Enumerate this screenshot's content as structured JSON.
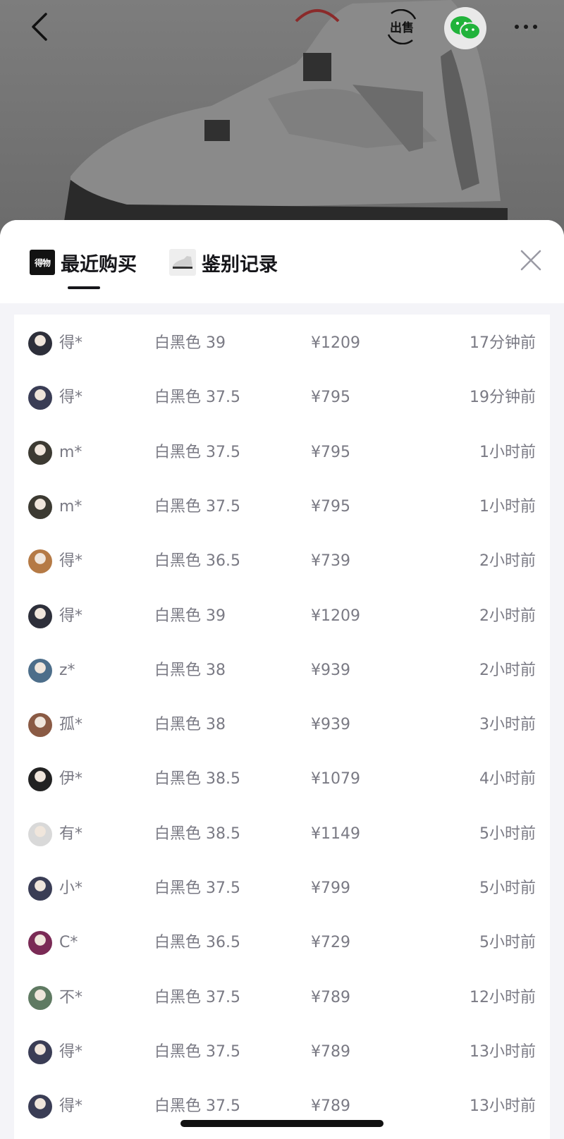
{
  "topbar": {
    "back_icon": "chevron-left-icon",
    "sell_icon": "sell-label-icon",
    "sell_label": "出售",
    "wechat_icon": "wechat-icon",
    "more_icon": "more-dots-icon"
  },
  "tabs": [
    {
      "label": "最近购买",
      "icon": "dewu-logo-icon",
      "icon_text": "得物",
      "active": true
    },
    {
      "label": "鉴别记录",
      "icon": "sneaker-thumbnail-icon",
      "active": false
    }
  ],
  "close_icon": "close-icon",
  "purchases": [
    {
      "name": "得*",
      "spec": "白黑色 39",
      "price": "¥1209",
      "time": "17分钟前",
      "avatar_color": "#2d2f3a"
    },
    {
      "name": "得*",
      "spec": "白黑色 37.5",
      "price": "¥795",
      "time": "19分钟前",
      "avatar_color": "#3a3d55"
    },
    {
      "name": "m*",
      "spec": "白黑色 37.5",
      "price": "¥795",
      "time": "1小时前",
      "avatar_color": "#3c3a32"
    },
    {
      "name": "m*",
      "spec": "白黑色 37.5",
      "price": "¥795",
      "time": "1小时前",
      "avatar_color": "#3c3a32"
    },
    {
      "name": "得*",
      "spec": "白黑色 36.5",
      "price": "¥739",
      "time": "2小时前",
      "avatar_color": "#b57a45"
    },
    {
      "name": "得*",
      "spec": "白黑色 39",
      "price": "¥1209",
      "time": "2小时前",
      "avatar_color": "#2d2f3a"
    },
    {
      "name": "z*",
      "spec": "白黑色 38",
      "price": "¥939",
      "time": "2小时前",
      "avatar_color": "#4d6e8a"
    },
    {
      "name": "孤*",
      "spec": "白黑色 38",
      "price": "¥939",
      "time": "3小时前",
      "avatar_color": "#8a5a44"
    },
    {
      "name": "伊*",
      "spec": "白黑色 38.5",
      "price": "¥1079",
      "time": "4小时前",
      "avatar_color": "#222222"
    },
    {
      "name": "有*",
      "spec": "白黑色 38.5",
      "price": "¥1149",
      "time": "5小时前",
      "avatar_color": "#d9d9d9"
    },
    {
      "name": "小*",
      "spec": "白黑色 37.5",
      "price": "¥799",
      "time": "5小时前",
      "avatar_color": "#3a3d55"
    },
    {
      "name": "C*",
      "spec": "白黑色 36.5",
      "price": "¥729",
      "time": "5小时前",
      "avatar_color": "#7a2a55"
    },
    {
      "name": "不*",
      "spec": "白黑色 37.5",
      "price": "¥789",
      "time": "12小时前",
      "avatar_color": "#5f7a62"
    },
    {
      "name": "得*",
      "spec": "白黑色 37.5",
      "price": "¥789",
      "time": "13小时前",
      "avatar_color": "#3a3d55"
    },
    {
      "name": "得*",
      "spec": "白黑色 37.5",
      "price": "¥789",
      "time": "13小时前",
      "avatar_color": "#3a3d55"
    }
  ]
}
